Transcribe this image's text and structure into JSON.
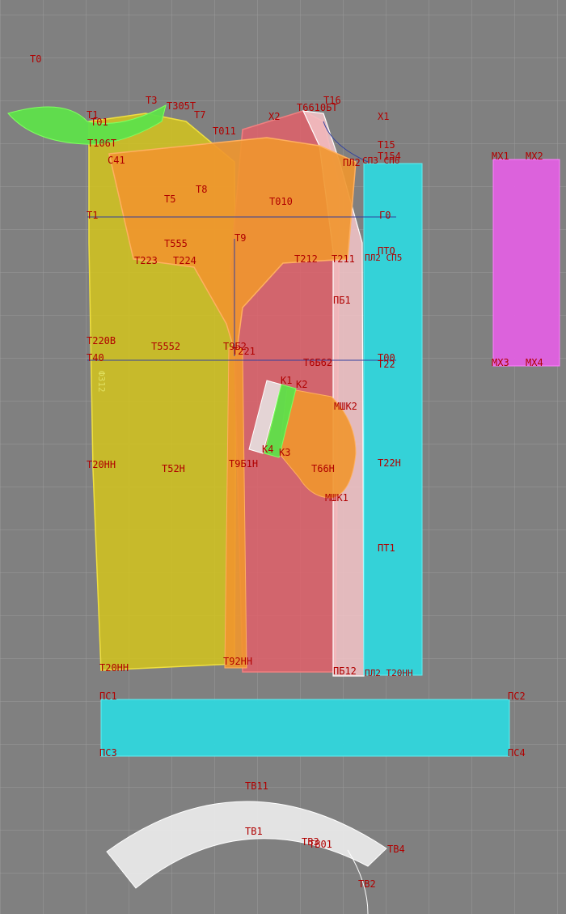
{
  "canvas": {
    "background": "#808080",
    "grid_color": "#9a9a9a"
  },
  "colors": {
    "yellow": "#d4c41c",
    "orange": "#f0962d",
    "red": "#e0606a",
    "pink": "#f4c4c8",
    "cyan": "#2fd6dc",
    "magenta": "#e060e0",
    "green": "#5ee04a",
    "white": "#e8e8e8",
    "label": "#b00000"
  },
  "labels": {
    "t0": "T0",
    "t1": "T1",
    "t01": "T01",
    "t106t": "T106T",
    "t3": "T3",
    "t305t": "T305T",
    "t7": "T7",
    "t011": "T011",
    "x2": "X2",
    "t661": "T6610БT",
    "t16": "T16",
    "x1": "X1",
    "t15": "T15",
    "t154": "T154",
    "c41": "C41",
    "pl2": "ПЛ2",
    "sp3": "СП3 СП6",
    "t5": "T5",
    "t8": "T8",
    "t010": "T010",
    "t1b": "T1",
    "g0": "Г0",
    "t555": "T555",
    "t9": "T9",
    "pto": "ПТО",
    "t223": "T223",
    "t224": "T224",
    "t212": "T212",
    "t211": "T211",
    "pl2b": "ПЛ2 СП5",
    "pb1": "ПБ1",
    "t220b": "T220B",
    "t552": "T5552",
    "t92": "T9Б2",
    "t221": "T221",
    "t40": "T40",
    "t662": "T6Б62",
    "t22": "T22",
    "t00": "T00",
    "k1": "K1",
    "k2": "K2",
    "mshk2": "МШК2",
    "k4": "K4",
    "k3": "K3",
    "t20n": "T20HH",
    "t5h": "T52H",
    "t9h": "T9Б1H",
    "t6h": "T66H",
    "t22h": "T22H",
    "mshk1": "МШК1",
    "pt1": "ПТ1",
    "t20nn": "T20HH",
    "t92n": "T92НН",
    "pb12": "ПБ12",
    "pl2n": "ПЛ2 T20НН",
    "mx1": "MX1",
    "mx2": "MX2",
    "mx3": "MX3",
    "mx4": "MX4",
    "ps1": "ПС1",
    "ps2": "ПС2",
    "ps3": "ПС3",
    "ps4": "ПС4",
    "tb11": "TB11",
    "tb1": "TB1",
    "tb3": "TB3",
    "tb01": "TB01",
    "tb4": "TB4",
    "tb2": "TB2",
    "side": "Ф312"
  }
}
